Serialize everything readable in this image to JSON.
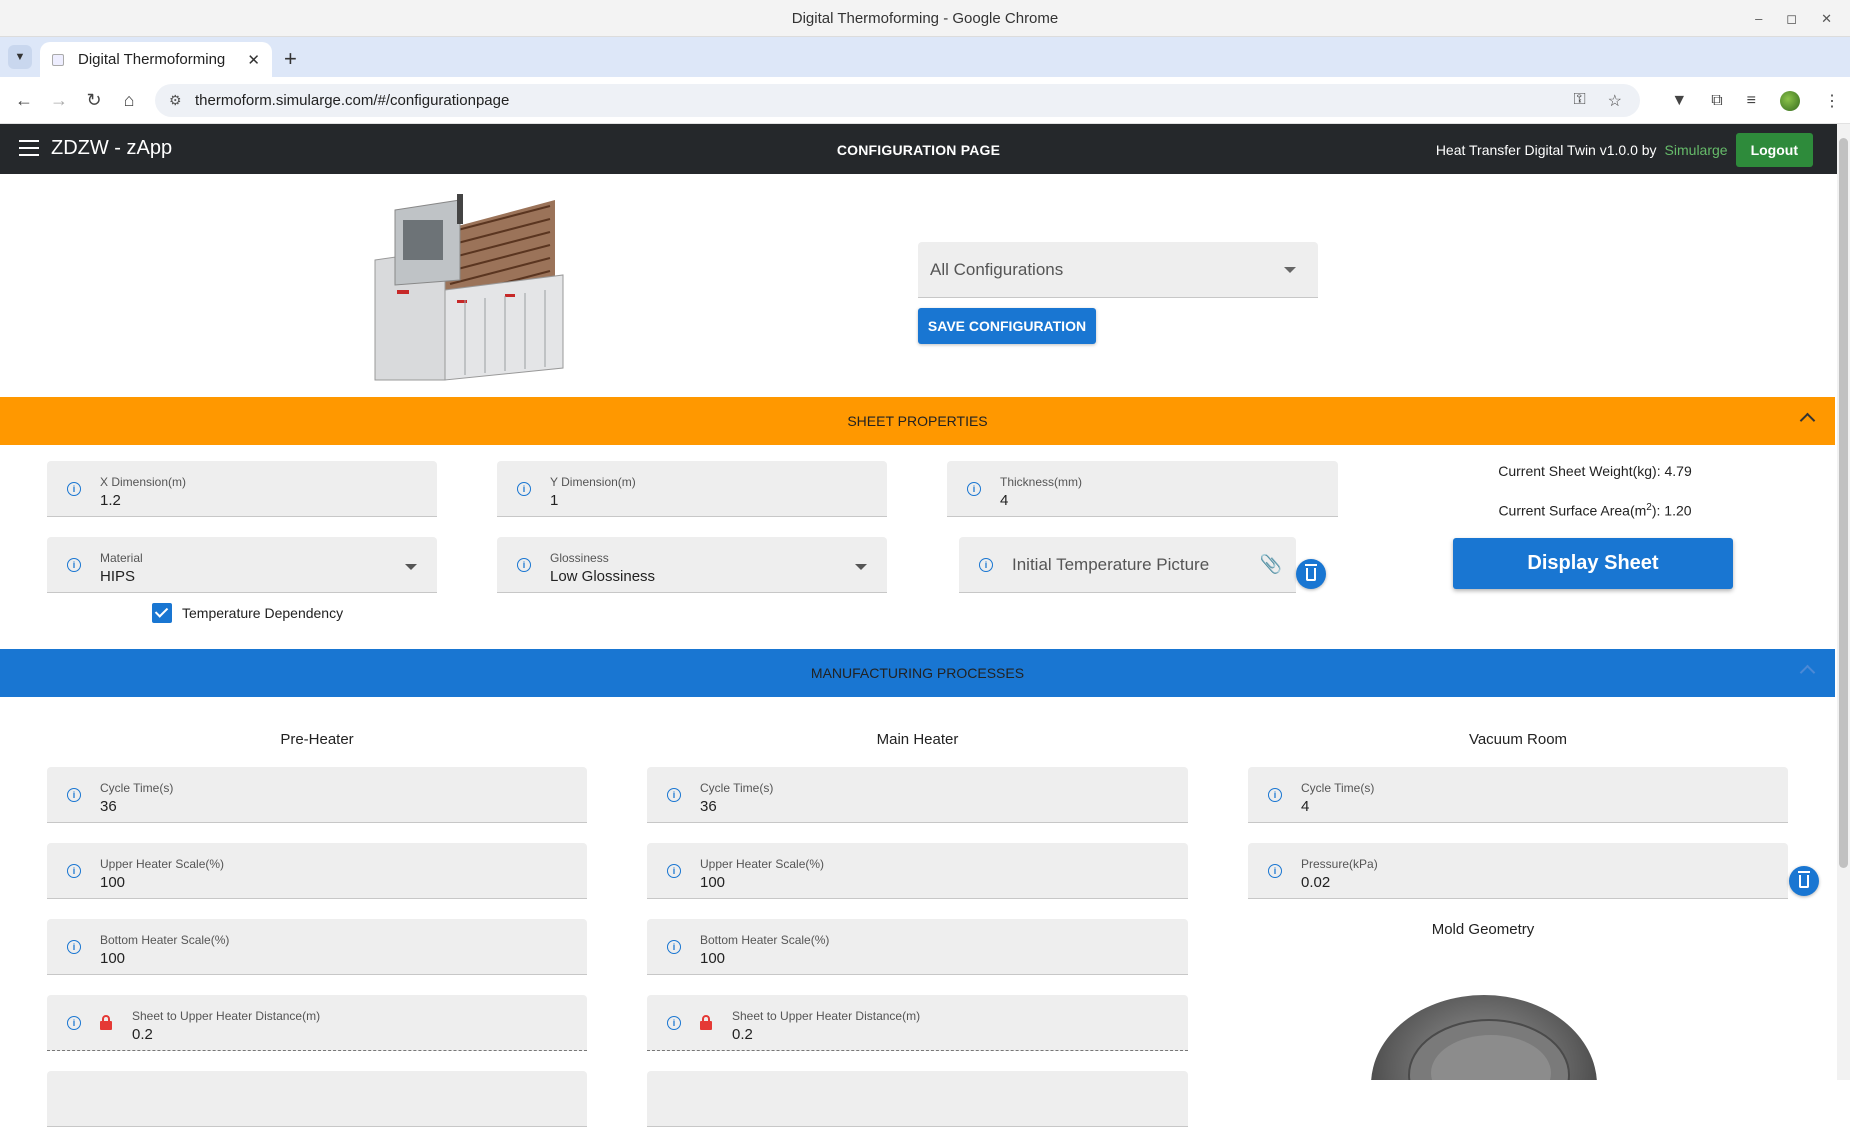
{
  "window": {
    "title": "Digital Thermoforming - Google Chrome"
  },
  "browser": {
    "tab_title": "Digital Thermoforming",
    "url": "thermoform.simularge.com/#/configurationpage"
  },
  "app": {
    "title": "ZDZW - zApp",
    "page_title": "CONFIGURATION PAGE",
    "subtitle": "Heat Transfer Digital Twin v1.0.0 by",
    "brand": "Simularge",
    "logout_label": "Logout"
  },
  "config": {
    "select_value": "All Configurations",
    "save_label": "SAVE CONFIGURATION"
  },
  "sheet": {
    "section_title": "SHEET PROPERTIES",
    "x_dim": {
      "label": "X Dimension(m)",
      "value": "1.2"
    },
    "y_dim": {
      "label": "Y Dimension(m)",
      "value": "1"
    },
    "thickness": {
      "label": "Thickness(mm)",
      "value": "4"
    },
    "material": {
      "label": "Material",
      "value": "HIPS"
    },
    "glossiness": {
      "label": "Glossiness",
      "value": "Low Glossiness"
    },
    "initial_temp_placeholder": "Initial Temperature Picture",
    "temperature_dependency_label": "Temperature Dependency",
    "weight_text": "Current Sheet Weight(kg): 4.79",
    "area_prefix": "Current Surface Area(m",
    "area_sup": "2",
    "area_suffix": "): 1.20",
    "display_label": "Display Sheet"
  },
  "processes": {
    "section_title": "MANUFACTURING PROCESSES",
    "pre_heater": {
      "title": "Pre-Heater",
      "cycle": {
        "label": "Cycle Time(s)",
        "value": "36"
      },
      "upper": {
        "label": "Upper Heater Scale(%)",
        "value": "100"
      },
      "bottom": {
        "label": "Bottom Heater Scale(%)",
        "value": "100"
      },
      "distance": {
        "label": "Sheet to Upper Heater Distance(m)",
        "value": "0.2"
      }
    },
    "main_heater": {
      "title": "Main Heater",
      "cycle": {
        "label": "Cycle Time(s)",
        "value": "36"
      },
      "upper": {
        "label": "Upper Heater Scale(%)",
        "value": "100"
      },
      "bottom": {
        "label": "Bottom Heater Scale(%)",
        "value": "100"
      },
      "distance": {
        "label": "Sheet to Upper Heater Distance(m)",
        "value": "0.2"
      }
    },
    "vacuum_room": {
      "title": "Vacuum Room",
      "cycle": {
        "label": "Cycle Time(s)",
        "value": "4"
      },
      "pressure": {
        "label": "Pressure(kPa)",
        "value": "0.02"
      },
      "mold_title": "Mold Geometry"
    }
  },
  "colors": {
    "orange": "#ff9800",
    "blue": "#1976d2",
    "green": "#2e8b3b",
    "header": "#25282b"
  }
}
